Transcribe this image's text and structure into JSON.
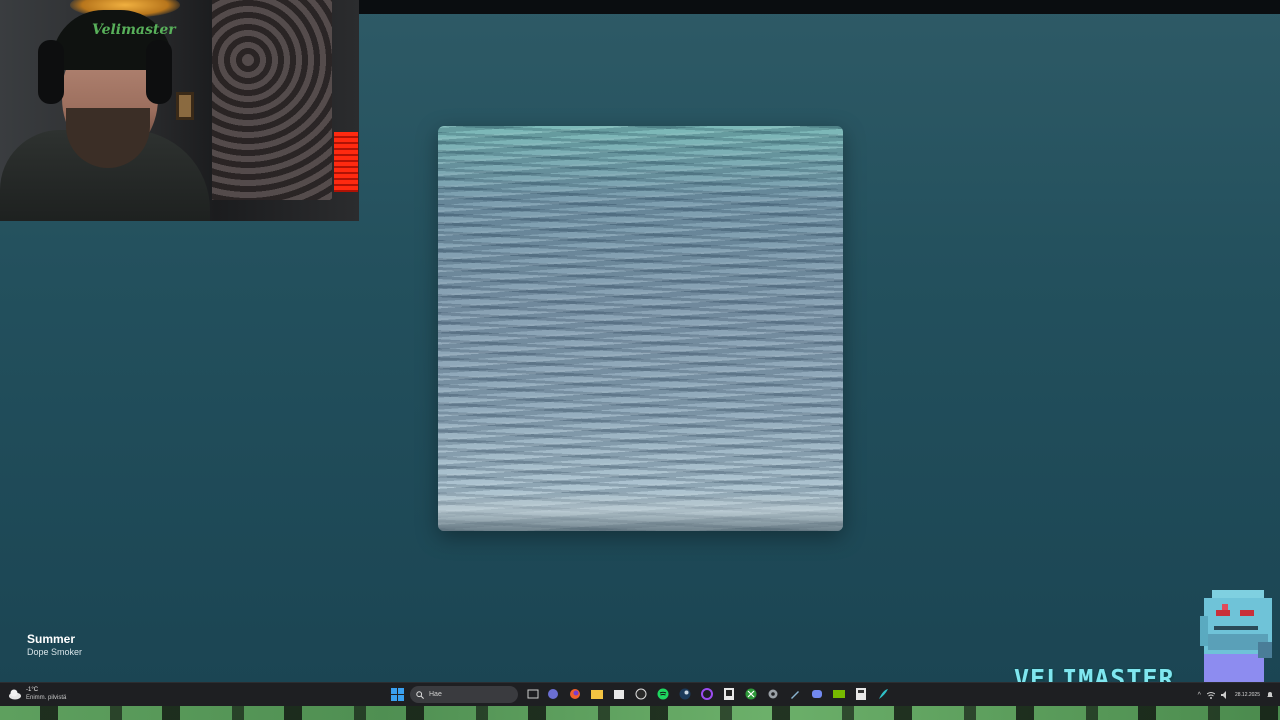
{
  "track": {
    "title": "Summer",
    "artist": "Dope Smoker"
  },
  "webcam": {
    "cap_text": "Velimaster"
  },
  "branding": {
    "name": "VELIMASTER"
  },
  "taskbar": {
    "weather_temp": "-1°C",
    "weather_desc": "Enimm. pilvistä",
    "search_placeholder": "Hae",
    "date": "28.12.2025"
  },
  "colors": {
    "background_top": "#2e5a66",
    "background_bottom": "#1b4553",
    "taskbar": "#1e1f22",
    "brand": "#7fe6ef"
  },
  "icons": [
    "windows-start-icon",
    "task-view-icon",
    "teams-icon",
    "firefox-icon",
    "file-explorer-icon",
    "store-icon",
    "obs-icon",
    "spotify-icon",
    "steam-icon",
    "circle-app-icon",
    "epic-games-icon",
    "xbox-icon",
    "settings-icon",
    "tool-icon",
    "discord-icon",
    "nvidia-icon",
    "calculator-icon",
    "feather-icon"
  ]
}
